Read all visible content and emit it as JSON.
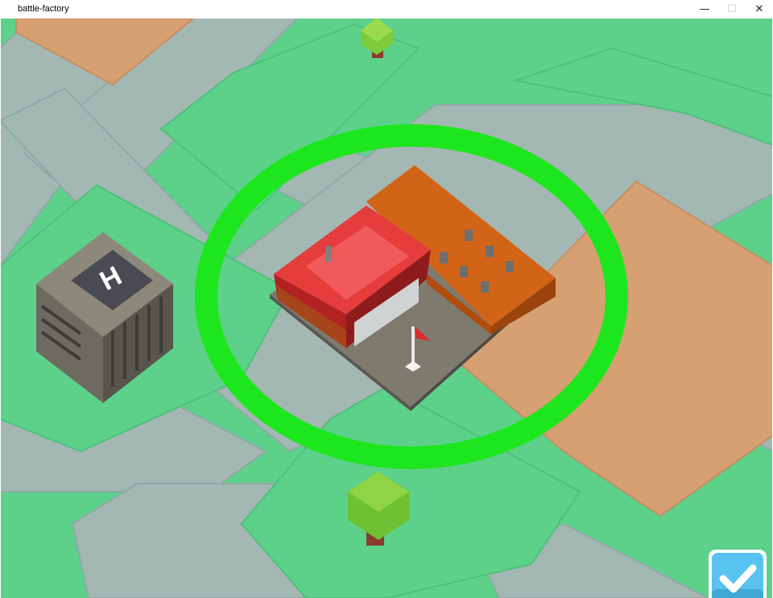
{
  "window": {
    "title": "battle-factory",
    "minimize_glyph": "—",
    "maximize_glyph": "☐",
    "close_glyph": "✕"
  },
  "scene": {
    "helipad_letter": "H",
    "colors": {
      "grass": "#5dd08a",
      "grass_edge": "#4ec07c",
      "road": "#a3b7b3",
      "dirt": "#d6a073",
      "selection_ring": "#1ee61e",
      "red_roof": "#e53c3c",
      "orange_roof": "#d26418",
      "confirm_button": "#58c3f0"
    }
  },
  "icons": {
    "confirm": "checkmark-icon",
    "minimize": "minimize-icon",
    "maximize": "maximize-icon",
    "close": "close-icon"
  }
}
